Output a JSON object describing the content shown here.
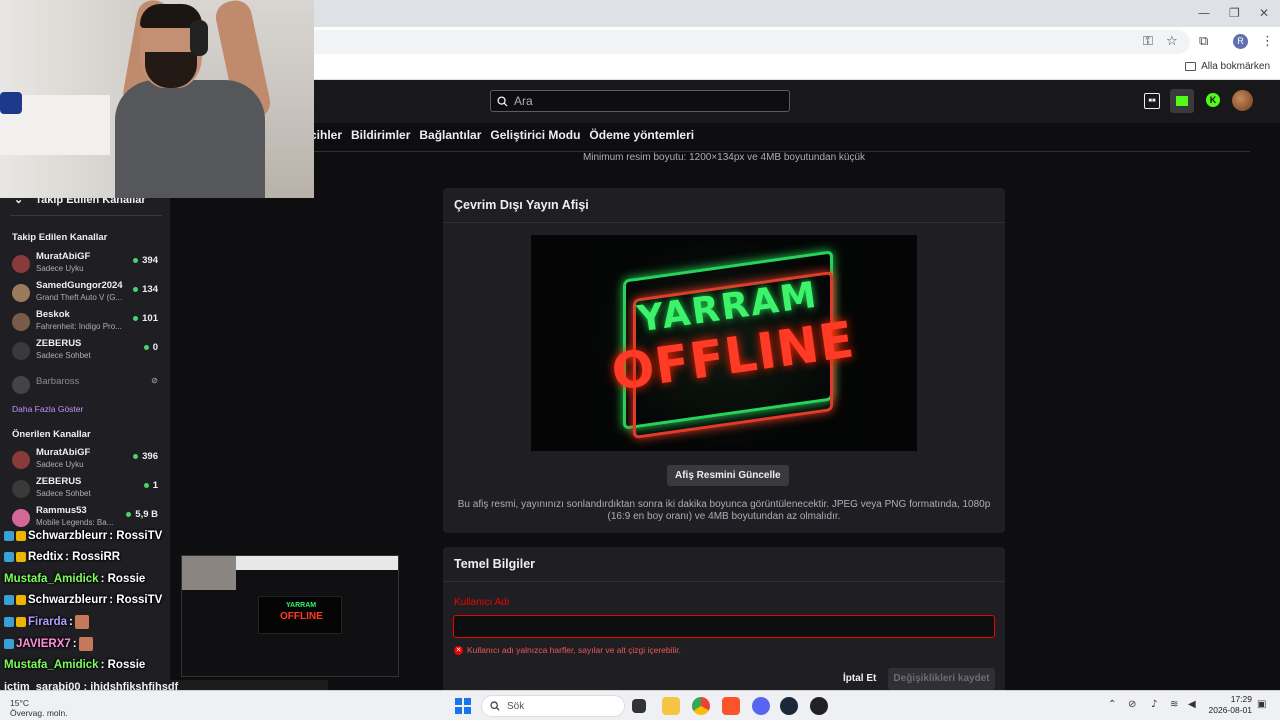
{
  "browser": {
    "bookmarks_all": "Alla bokmärken",
    "profile_initial": "R"
  },
  "header": {
    "search_placeholder": "Ara"
  },
  "settings_tabs": [
    "cihler",
    "Bildirimler",
    "Bağlantılar",
    "Geliştirici Modu",
    "Ödeme yöntemleri"
  ],
  "sidebar": {
    "collapse_label": "Takip Edilen Kanallar",
    "followed_heading": "Takip Edilen Kanallar",
    "followed": [
      {
        "name": "MuratAbiGF",
        "game": "Sadece Uyku",
        "count": "394",
        "live": true
      },
      {
        "name": "SamedGungor2024",
        "game": "Grand Theft Auto V (G...",
        "count": "134",
        "live": true
      },
      {
        "name": "Beskok",
        "game": "Fahrenheit: Indigo Pro...",
        "count": "101",
        "live": true
      },
      {
        "name": "ZEBERUS",
        "game": "Sadece Sohbet",
        "count": "0",
        "live": true
      },
      {
        "name": "Barbaross",
        "game": "",
        "count": "",
        "live": false
      }
    ],
    "show_more": "Daha Fazla Göster",
    "recommended_heading": "Önerilen Kanallar",
    "recommended": [
      {
        "name": "MuratAbiGF",
        "game": "Sadece Uyku",
        "count": "396"
      },
      {
        "name": "ZEBERUS",
        "game": "Sadece Sohbet",
        "count": "1"
      },
      {
        "name": "Rammus53",
        "game": "Mobile Legends: Ba...",
        "count": "5,9 B"
      }
    ]
  },
  "content": {
    "min_size_note": "Minimum resim boyutu: 1200×134px ve 4MB boyutundan küçük",
    "offline_panel": {
      "title": "Çevrim Dışı Yayın Afişi",
      "image_text_top": "YARRAM",
      "image_text_bottom": "OFFLINE",
      "update_button": "Afiş Resmini Güncelle",
      "description": "Bu afiş resmi, yayınınızı sonlandırdıktan sonra iki dakika boyunca görüntülenecektir. JPEG veya PNG formatında, 1080p (16:9 en boy oranı) ve 4MB boyutundan az olmalıdır."
    },
    "basic_info": {
      "title": "Temel Bilgiler",
      "username_label": "Kullanıcı Adı",
      "username_value": "",
      "error": "Kullanıcı adı yalnızca harfler, sayılar ve alt çizgi içerebilir.",
      "cancel": "İptal Et",
      "save": "Değişiklikleri kaydet"
    }
  },
  "chat": [
    {
      "user": "Schwarzbleurr",
      "msg": " : RossiTV",
      "color": "#ffffff"
    },
    {
      "user": "Redtix",
      "msg": " : RossiRR",
      "color": "#ffffff"
    },
    {
      "user": "Mustafa_Amidick",
      "msg": " : Rossie",
      "color": "#7cfc5a"
    },
    {
      "user": "Schwarzbleurr",
      "msg": " : RossiTV",
      "color": "#ffffff"
    },
    {
      "user": "Firarda",
      "msg": " :",
      "color": "#b39cff"
    },
    {
      "user": "JAVIERX7",
      "msg": " :",
      "color": "#ff8fd8"
    },
    {
      "user": "Mustafa_Amidick",
      "msg": " : Rossie",
      "color": "#7cfc5a"
    }
  ],
  "chat_last": "ictim_sarabi00 : jhjdshfjkshfjhsdf",
  "taskbar": {
    "weather_temp": "15°C",
    "weather_desc": "Övervag. moln.",
    "search": "Sök",
    "time": "17:29",
    "date": "2026-08-01"
  },
  "colors": {
    "accent": "#bf94ff",
    "live": "#44d66c",
    "error": "#eb0400"
  }
}
